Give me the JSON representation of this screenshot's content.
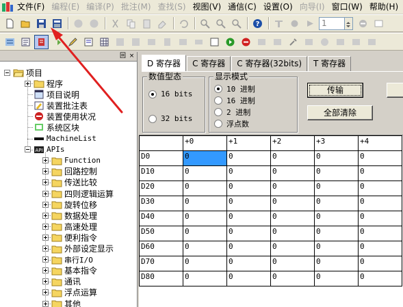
{
  "menu": [
    "文件(F)",
    "编程(E)",
    "编译(P)",
    "批注(M)",
    "查找(S)",
    "视图(V)",
    "通信(C)",
    "设置(O)",
    "向导(I)",
    "窗口(W)",
    "帮助(H)"
  ],
  "menu_disabled": [
    false,
    true,
    true,
    true,
    true,
    false,
    false,
    false,
    true,
    false,
    false
  ],
  "toolbar": {
    "number_field": "1"
  },
  "tree": {
    "root": "项目",
    "items": [
      {
        "label": "程序",
        "icon": "folder-icon"
      },
      {
        "label": "项目说明",
        "icon": "document-icon"
      },
      {
        "label": "装置批注表",
        "icon": "edit-icon"
      },
      {
        "label": "装置使用状况",
        "icon": "status-icon"
      },
      {
        "label": "系统区块",
        "icon": "block-icon"
      },
      {
        "label": "MachineList",
        "icon": "list-icon"
      },
      {
        "label": "APIs",
        "icon": "api-icon"
      }
    ],
    "apis": [
      "Function",
      "回路控制",
      "传送比较",
      "四则逻辑运算",
      "旋转位移",
      "数据处理",
      "高速处理",
      "便利指令",
      "外部设定显示",
      "串行I/O",
      "基本指令",
      "通讯",
      "浮点运算",
      "其他"
    ]
  },
  "tabs": [
    "D 寄存器",
    "C 寄存器",
    "C 寄存器(32bits)",
    "T 寄存器"
  ],
  "data_type": {
    "title": "数值型态",
    "options": [
      "16 bits",
      "32 bits"
    ],
    "selected": 0
  },
  "display_mode": {
    "title": "显示模式",
    "options": [
      "10 进制",
      "16 进制",
      "2 进制",
      "浮点数"
    ],
    "selected": 0
  },
  "buttons": {
    "transfer": "传输",
    "clear_all": "全部清除"
  },
  "grid": {
    "columns": [
      "+0",
      "+1",
      "+2",
      "+3",
      "+4"
    ],
    "rows": [
      {
        "label": "D0",
        "values": [
          "0",
          "0",
          "0",
          "0",
          "0"
        ]
      },
      {
        "label": "D10",
        "values": [
          "0",
          "0",
          "0",
          "0",
          "0"
        ]
      },
      {
        "label": "D20",
        "values": [
          "0",
          "0",
          "0",
          "0",
          "0"
        ]
      },
      {
        "label": "D30",
        "values": [
          "0",
          "0",
          "0",
          "0",
          "0"
        ]
      },
      {
        "label": "D40",
        "values": [
          "0",
          "0",
          "0",
          "0",
          "0"
        ]
      },
      {
        "label": "D50",
        "values": [
          "0",
          "0",
          "0",
          "0",
          "0"
        ]
      },
      {
        "label": "D60",
        "values": [
          "0",
          "0",
          "0",
          "0",
          "0"
        ]
      },
      {
        "label": "D70",
        "values": [
          "0",
          "0",
          "0",
          "0",
          "0"
        ]
      },
      {
        "label": "D80",
        "values": [
          "0",
          "0",
          "0",
          "0",
          "0"
        ]
      }
    ]
  },
  "colors": {
    "arrow": "#e02020",
    "selection": "#3399ff"
  }
}
